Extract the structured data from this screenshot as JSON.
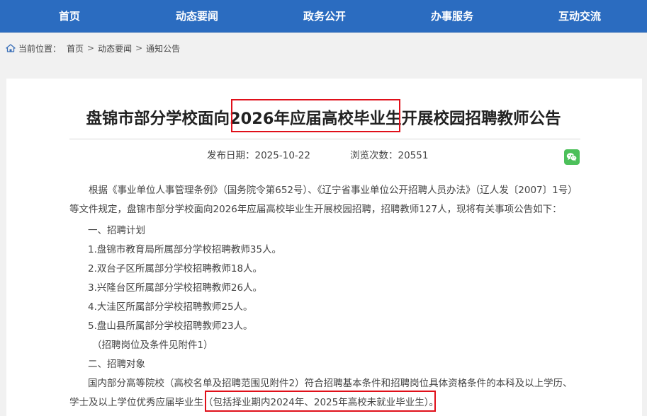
{
  "nav": {
    "items": [
      "首页",
      "动态要闻",
      "政务公开",
      "办事服务",
      "互动交流"
    ]
  },
  "breadcrumb": {
    "label": "当前位置：",
    "items": [
      "首页",
      "动态要闻",
      "通知公告"
    ],
    "separator": ">"
  },
  "article": {
    "title": "盘锦市部分学校面向2026年应届高校毕业生开展校园招聘教师公告",
    "publish_label": "发布日期：",
    "publish_date": "2025-10-22",
    "views_label": "浏览次数：",
    "views": "20551",
    "intro": "根据《事业单位人事管理条例》（国务院令第652号）、《辽宁省事业单位公开招聘人员办法》（辽人发〔2007〕1号）等文件规定，盘锦市部分学校面向2026年应届高校毕业生开展校园招聘，招聘教师127人，现将有关事项公告如下：",
    "section1_heading": "一、招聘计划",
    "plan_items": [
      "1.盘锦市教育局所属部分学校招聘教师35人。",
      "2.双台子区所属部分学校招聘教师18人。",
      "3.兴隆台区所属部分学校招聘教师26人。",
      "4.大洼区所属部分学校招聘教师25人。",
      "5.盘山县所属部分学校招聘教师23人。"
    ],
    "plan_note": "（招聘岗位及条件见附件1）",
    "section2_heading": "二、招聘对象",
    "target_text_a": "国内部分高等院校（高校名单及招聘范围见附件2）符合招聘基本条件和招聘岗位具体资格条件的本科及以上学历、",
    "target_text_b": "学士及以上学位优秀应届毕业生",
    "target_text_c": "（包括择业期内2024年、2025年高校未就业毕业生）",
    "target_text_d": "。"
  },
  "colors": {
    "nav_bg": "#2b6cc0",
    "highlight": "#e0101a",
    "wechat": "#4cc05a"
  },
  "icons": {
    "home": "home-icon",
    "share": "wechat-icon"
  }
}
